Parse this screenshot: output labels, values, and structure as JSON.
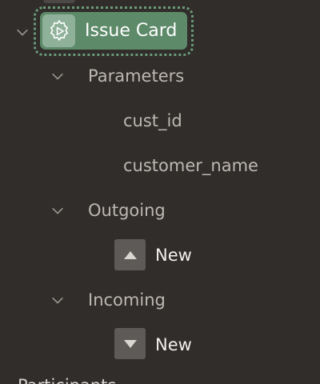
{
  "tree": {
    "selected": {
      "label": "Issue Card",
      "icon": "gear-play-icon"
    },
    "parameters": {
      "label": "Parameters",
      "items": [
        "cust_id",
        "customer_name"
      ]
    },
    "outgoing": {
      "label": "Outgoing",
      "item_label": "New",
      "icon": "arrow-up-icon"
    },
    "incoming": {
      "label": "Incoming",
      "item_label": "New",
      "icon": "arrow-down-icon"
    },
    "next_section_label": "Participants"
  },
  "colors": {
    "background": "#302d2b",
    "selected_green": "#5d8a69",
    "selected_icon_bg": "#8fb199",
    "text": "#d4d0cc",
    "arrow_box": "#5e5a57"
  }
}
